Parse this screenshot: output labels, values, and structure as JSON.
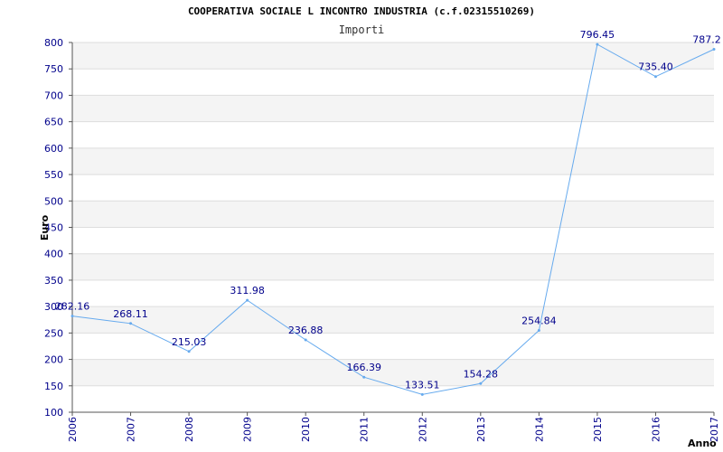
{
  "chart_data": {
    "type": "line",
    "title": "COOPERATIVA SOCIALE L INCONTRO INDUSTRIA (c.f.02315510269)",
    "subtitle": "Importi",
    "xlabel": "Anno",
    "ylabel": "Euro",
    "ylim": [
      100,
      800
    ],
    "yticks": [
      100,
      150,
      200,
      250,
      300,
      350,
      400,
      450,
      500,
      550,
      600,
      650,
      700,
      750,
      800
    ],
    "grid": true,
    "categories": [
      "2006",
      "2007",
      "2008",
      "2009",
      "2010",
      "2011",
      "2012",
      "2013",
      "2014",
      "2015",
      "2016",
      "2017"
    ],
    "series": [
      {
        "values": [
          282.16,
          268.11,
          215.03,
          311.98,
          236.88,
          166.39,
          133.51,
          154.28,
          254.84,
          796.45,
          735.4,
          787.2
        ],
        "labels": [
          "282.16",
          "268.11",
          "215.03",
          "311.98",
          "236.88",
          "166.39",
          "133.51",
          "154.28",
          "254.84",
          "796.45",
          "735.40",
          "787.2"
        ],
        "color": "#66aaee"
      }
    ]
  }
}
